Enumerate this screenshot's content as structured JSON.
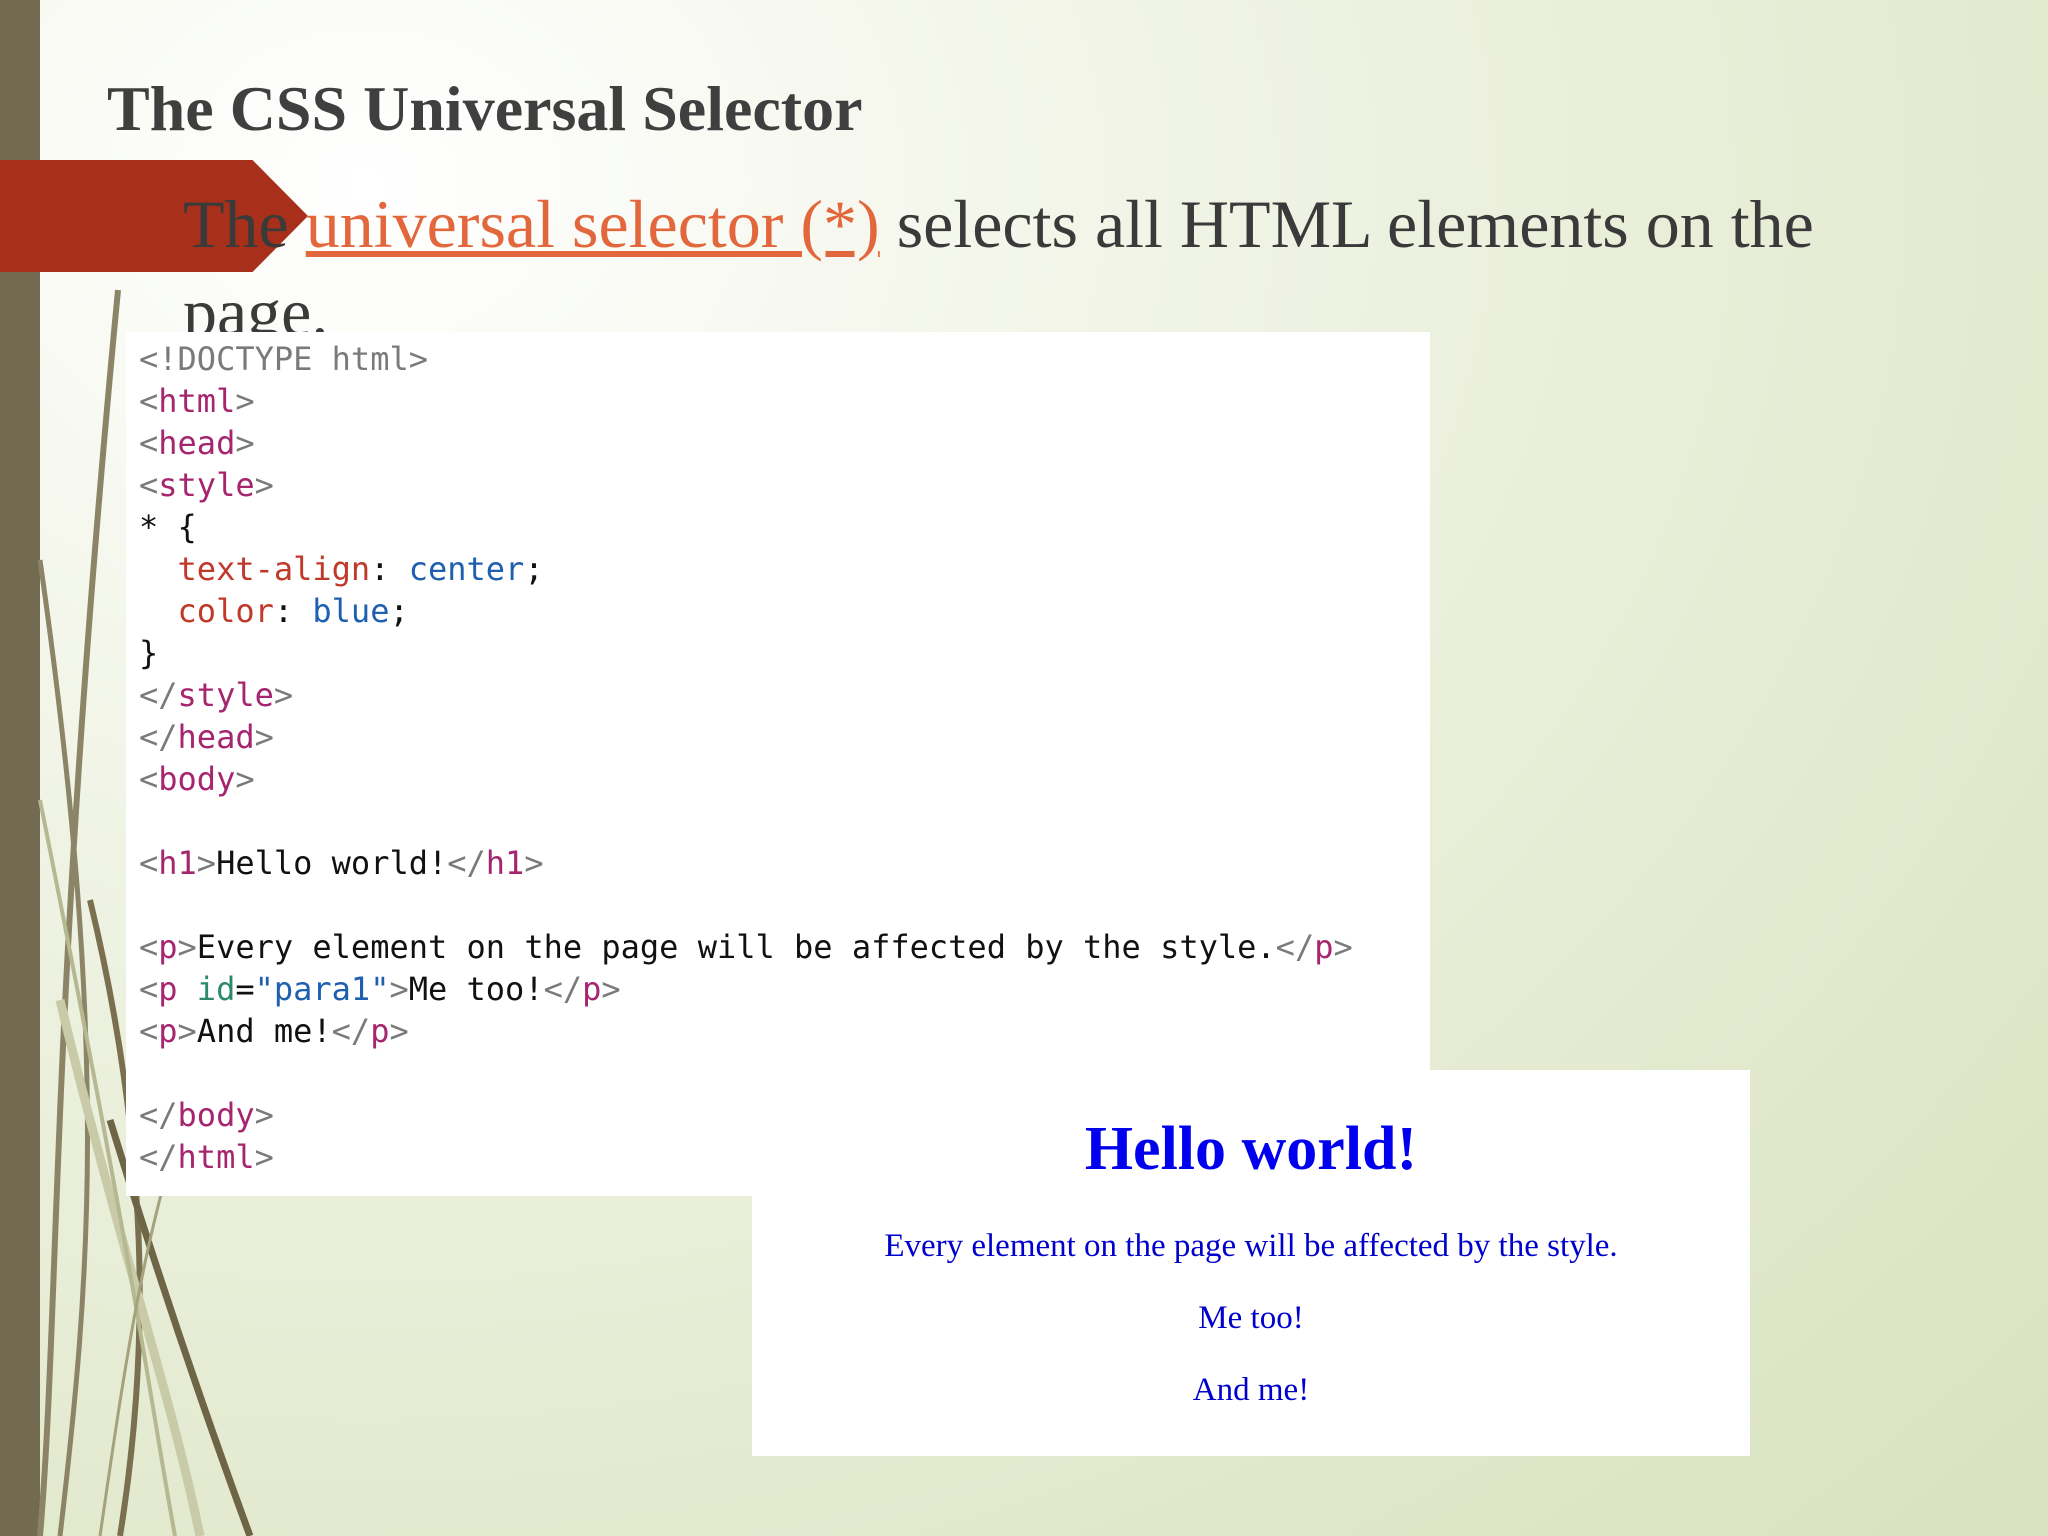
{
  "slide": {
    "title": "The CSS Universal Selector",
    "bullet": {
      "prefix": "The ",
      "link_text": "universal selector (*)",
      "suffix": " selects all HTML elements on the page."
    }
  },
  "code_lines": [
    [
      {
        "t": "br",
        "s": "<!DOCTYPE html>"
      }
    ],
    [
      {
        "t": "br",
        "s": "<"
      },
      {
        "t": "tag",
        "s": "html"
      },
      {
        "t": "br",
        "s": ">"
      }
    ],
    [
      {
        "t": "br",
        "s": "<"
      },
      {
        "t": "tag",
        "s": "head"
      },
      {
        "t": "br",
        "s": ">"
      }
    ],
    [
      {
        "t": "br",
        "s": "<"
      },
      {
        "t": "tag",
        "s": "style"
      },
      {
        "t": "br",
        "s": ">"
      }
    ],
    [
      {
        "t": "txt",
        "s": "* {"
      }
    ],
    [
      {
        "t": "txt",
        "s": "  "
      },
      {
        "t": "prop",
        "s": "text-align"
      },
      {
        "t": "txt",
        "s": ": "
      },
      {
        "t": "val",
        "s": "center"
      },
      {
        "t": "txt",
        "s": ";"
      }
    ],
    [
      {
        "t": "txt",
        "s": "  "
      },
      {
        "t": "prop",
        "s": "color"
      },
      {
        "t": "txt",
        "s": ": "
      },
      {
        "t": "val",
        "s": "blue"
      },
      {
        "t": "txt",
        "s": ";"
      }
    ],
    [
      {
        "t": "txt",
        "s": "}"
      }
    ],
    [
      {
        "t": "br",
        "s": "</"
      },
      {
        "t": "tag",
        "s": "style"
      },
      {
        "t": "br",
        "s": ">"
      }
    ],
    [
      {
        "t": "br",
        "s": "</"
      },
      {
        "t": "tag",
        "s": "head"
      },
      {
        "t": "br",
        "s": ">"
      }
    ],
    [
      {
        "t": "br",
        "s": "<"
      },
      {
        "t": "tag",
        "s": "body"
      },
      {
        "t": "br",
        "s": ">"
      }
    ],
    [],
    [
      {
        "t": "br",
        "s": "<"
      },
      {
        "t": "tag",
        "s": "h1"
      },
      {
        "t": "br",
        "s": ">"
      },
      {
        "t": "txt",
        "s": "Hello world!"
      },
      {
        "t": "br",
        "s": "</"
      },
      {
        "t": "tag",
        "s": "h1"
      },
      {
        "t": "br",
        "s": ">"
      }
    ],
    [],
    [
      {
        "t": "br",
        "s": "<"
      },
      {
        "t": "tag",
        "s": "p"
      },
      {
        "t": "br",
        "s": ">"
      },
      {
        "t": "txt",
        "s": "Every element on the page will be affected by the style."
      },
      {
        "t": "br",
        "s": "</"
      },
      {
        "t": "tag",
        "s": "p"
      },
      {
        "t": "br",
        "s": ">"
      }
    ],
    [
      {
        "t": "br",
        "s": "<"
      },
      {
        "t": "tag",
        "s": "p"
      },
      {
        "t": "txt",
        "s": " "
      },
      {
        "t": "attr",
        "s": "id"
      },
      {
        "t": "txt",
        "s": "="
      },
      {
        "t": "str",
        "s": "\"para1\""
      },
      {
        "t": "br",
        "s": ">"
      },
      {
        "t": "txt",
        "s": "Me too!"
      },
      {
        "t": "br",
        "s": "</"
      },
      {
        "t": "tag",
        "s": "p"
      },
      {
        "t": "br",
        "s": ">"
      }
    ],
    [
      {
        "t": "br",
        "s": "<"
      },
      {
        "t": "tag",
        "s": "p"
      },
      {
        "t": "br",
        "s": ">"
      },
      {
        "t": "txt",
        "s": "And me!"
      },
      {
        "t": "br",
        "s": "</"
      },
      {
        "t": "tag",
        "s": "p"
      },
      {
        "t": "br",
        "s": ">"
      }
    ],
    [],
    [
      {
        "t": "br",
        "s": "</"
      },
      {
        "t": "tag",
        "s": "body"
      },
      {
        "t": "br",
        "s": ">"
      }
    ],
    [
      {
        "t": "br",
        "s": "</"
      },
      {
        "t": "tag",
        "s": "html"
      },
      {
        "t": "br",
        "s": ">"
      }
    ]
  ],
  "output": {
    "heading": "Hello world!",
    "paragraphs": [
      "Every element on the page will be affected by the style.",
      "Me too!",
      "And me!"
    ]
  },
  "colors": {
    "accent_arrow": "#a8301a",
    "link": "#e2673c",
    "left_bar": "#736a52",
    "output_text": "#0000ee"
  }
}
